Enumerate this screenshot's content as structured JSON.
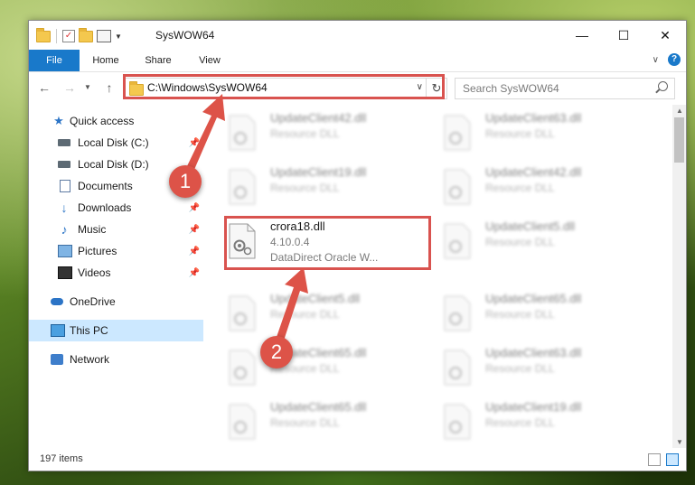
{
  "window": {
    "title": "SysWOW64"
  },
  "ribbon": {
    "tabs": [
      "File",
      "Home",
      "Share",
      "View"
    ]
  },
  "address": {
    "path": "C:\\Windows\\SysWOW64"
  },
  "search": {
    "placeholder": "Search SysWOW64"
  },
  "sidebar": {
    "quick_access": "Quick access",
    "items": [
      {
        "label": "Local Disk (C:)",
        "icon": "drive-icon",
        "pinned": true
      },
      {
        "label": "Local Disk (D:)",
        "icon": "drive-icon",
        "pinned": false
      },
      {
        "label": "Documents",
        "icon": "documents-icon",
        "pinned": true
      },
      {
        "label": "Downloads",
        "icon": "downloads-icon",
        "pinned": true
      },
      {
        "label": "Music",
        "icon": "music-icon",
        "pinned": true
      },
      {
        "label": "Pictures",
        "icon": "pictures-icon",
        "pinned": true
      },
      {
        "label": "Videos",
        "icon": "videos-icon",
        "pinned": true
      }
    ],
    "onedrive": "OneDrive",
    "thispc": "This PC",
    "network": "Network"
  },
  "files": {
    "highlighted": {
      "name": "crora18.dll",
      "version": "4.10.0.4",
      "description": "DataDirect Oracle W..."
    },
    "left": [
      {
        "name": "UpdateClient42.dll",
        "type": "Resource DLL"
      },
      {
        "name": "UpdateClient19.dll",
        "type": "Resource DLL"
      },
      {
        "name": "UpdateClient5.dll",
        "type": "Resource DLL"
      },
      {
        "name": "UpdateClient65.dll",
        "type": "Resource DLL"
      },
      {
        "name": "UpdateClient65.dll",
        "type": "Resource DLL"
      }
    ],
    "right": [
      {
        "name": "UpdateClient63.dll",
        "type": "Resource DLL"
      },
      {
        "name": "UpdateClient42.dll",
        "type": "Resource DLL"
      },
      {
        "name": "UpdateClient5.dll",
        "type": "Resource DLL"
      },
      {
        "name": "UpdateClient65.dll",
        "type": "Resource DLL"
      },
      {
        "name": "UpdateClient63.dll",
        "type": "Resource DLL"
      },
      {
        "name": "UpdateClient19.dll",
        "type": "Resource DLL"
      }
    ]
  },
  "status": {
    "item_count": "197 items"
  },
  "annotations": {
    "step1": "1",
    "step2": "2",
    "color": "#dd5348"
  }
}
